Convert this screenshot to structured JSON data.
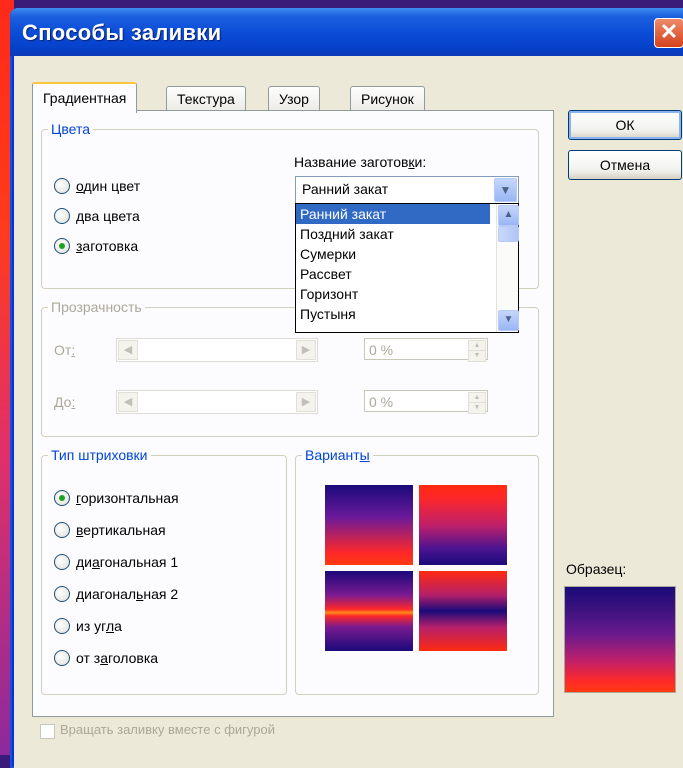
{
  "window": {
    "title": "Способы заливки",
    "close_glyph": "✕"
  },
  "tabs": [
    "Градиентная",
    "Текстура",
    "Узор",
    "Рисунок"
  ],
  "colors_group": {
    "title": "Цвета",
    "options": [
      {
        "prefix": "",
        "mnemonic": "о",
        "rest": "дин цвет",
        "checked": false
      },
      {
        "prefix": "",
        "mnemonic": "д",
        "rest": "ва цвета",
        "checked": false
      },
      {
        "prefix": "",
        "mnemonic": "з",
        "rest": "аготовка",
        "checked": true
      }
    ],
    "preset_label_prefix": "Название заготов",
    "preset_label_mnemonic": "к",
    "preset_label_suffix": "и:",
    "preset_value": "Ранний закат",
    "preset_options": [
      "Ранний закат",
      "Поздний закат",
      "Сумерки",
      "Рассвет",
      "Горизонт",
      "Пустыня"
    ],
    "preset_selected": 0
  },
  "transparency_group": {
    "title": "Прозрачность",
    "from_prefix": "От",
    "from_mnemonic": ":",
    "to_prefix": "До",
    "to_mnemonic": ":",
    "from_value": "0 %",
    "to_value": "0 %"
  },
  "shading_group": {
    "title": "Тип штриховки",
    "options": [
      {
        "prefix": "",
        "mnemonic": "г",
        "rest": "оризонтальная",
        "checked": true
      },
      {
        "prefix": "",
        "mnemonic": "в",
        "rest": "ертикальная",
        "checked": false
      },
      {
        "prefix": "ди",
        "mnemonic": "а",
        "rest": "гональная 1",
        "checked": false
      },
      {
        "prefix": "диагонал",
        "mnemonic": "ь",
        "rest": "ная 2",
        "checked": false
      },
      {
        "prefix": "из уг",
        "mnemonic": "л",
        "rest": "а",
        "checked": false
      },
      {
        "prefix": "от з",
        "mnemonic": "а",
        "rest": "головка",
        "checked": false
      }
    ]
  },
  "variants_group": {
    "title_prefix": "Вариант",
    "title_mnemonic": "ы"
  },
  "buttons": {
    "ok": "ОК",
    "cancel": "Отмена"
  },
  "sample_label": "Образец:",
  "rotate_label": "Вращать заливку вместе с фигурой",
  "icons": {
    "left": "◀",
    "right": "▶",
    "up": "▲",
    "down": "▼",
    "combo": "▼"
  }
}
